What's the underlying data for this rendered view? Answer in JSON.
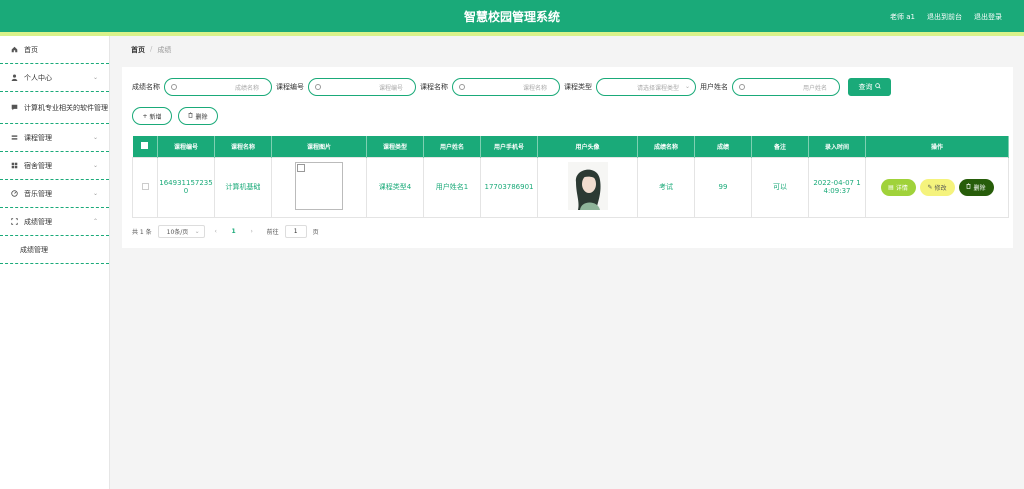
{
  "header": {
    "title": "智慧校园管理系统",
    "user_label": "老师 a1",
    "backend_link": "退出到前台",
    "logout_link": "退出登录"
  },
  "sidebar": {
    "items": [
      {
        "label": "首页",
        "icon": "home-icon"
      },
      {
        "label": "个人中心",
        "icon": "user-icon"
      },
      {
        "label": "计算机专业相关的软件管理",
        "icon": "chat-icon"
      },
      {
        "label": "课程管理",
        "icon": "layers-icon"
      },
      {
        "label": "宿舍管理",
        "icon": "grid-icon"
      },
      {
        "label": "音乐管理",
        "icon": "music-icon"
      },
      {
        "label": "成绩管理",
        "icon": "expand-icon"
      }
    ],
    "sub_item": "成绩管理"
  },
  "breadcrumb": {
    "home": "首页",
    "sep": "/",
    "current": "成绩"
  },
  "search": {
    "f1_label": "成绩名称",
    "f1_placeholder": "成绩名称",
    "f2_label": "课程编号",
    "f2_placeholder": "课程编号",
    "f3_label": "课程名称",
    "f3_placeholder": "课程名称",
    "f4_label": "课程类型",
    "f4_placeholder": "请选择课程类型",
    "f5_label": "用户姓名",
    "f5_placeholder": "用户姓名",
    "query_label": "查询"
  },
  "actions": {
    "add_label": "新增",
    "delete_label": "删除"
  },
  "table": {
    "headers": [
      "课程编号",
      "课程名称",
      "课程图片",
      "课程类型",
      "用户姓名",
      "用户手机号",
      "用户头像",
      "成绩名称",
      "成绩",
      "备注",
      "录入时间",
      "操作"
    ],
    "rows": [
      {
        "course_no_1": "164931157235",
        "course_no_2": "0",
        "course_name": "计算机基础",
        "course_type": "课程类型4",
        "user_name": "用户姓名1",
        "user_phone": "17703786901",
        "score_name": "考试",
        "score": "99",
        "remark": "可以",
        "time_1": "2022-04-07 1",
        "time_2": "4:09:37",
        "detail_label": "详情",
        "edit_label": "修改",
        "delete_label": "删除"
      }
    ]
  },
  "pager": {
    "total": "共 1 条",
    "page_size": "10条/页",
    "current_page": "1",
    "goto_label": "前往",
    "goto_value": "1",
    "page_suffix": "页"
  },
  "colors": {
    "accent": "#1aaa79",
    "stripe": "#d9f28a"
  }
}
